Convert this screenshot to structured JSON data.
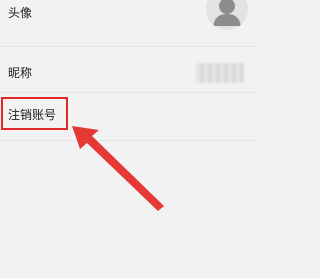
{
  "settings": {
    "avatar_label": "头像",
    "nickname_label": "昵称",
    "cancel_account_label": "注销账号"
  },
  "colors": {
    "highlight": "#e0272a",
    "arrow": "#e53935",
    "background": "#f2f2f2"
  },
  "icons": {
    "avatar": "default-user-icon",
    "annotation": "arrow-icon"
  }
}
